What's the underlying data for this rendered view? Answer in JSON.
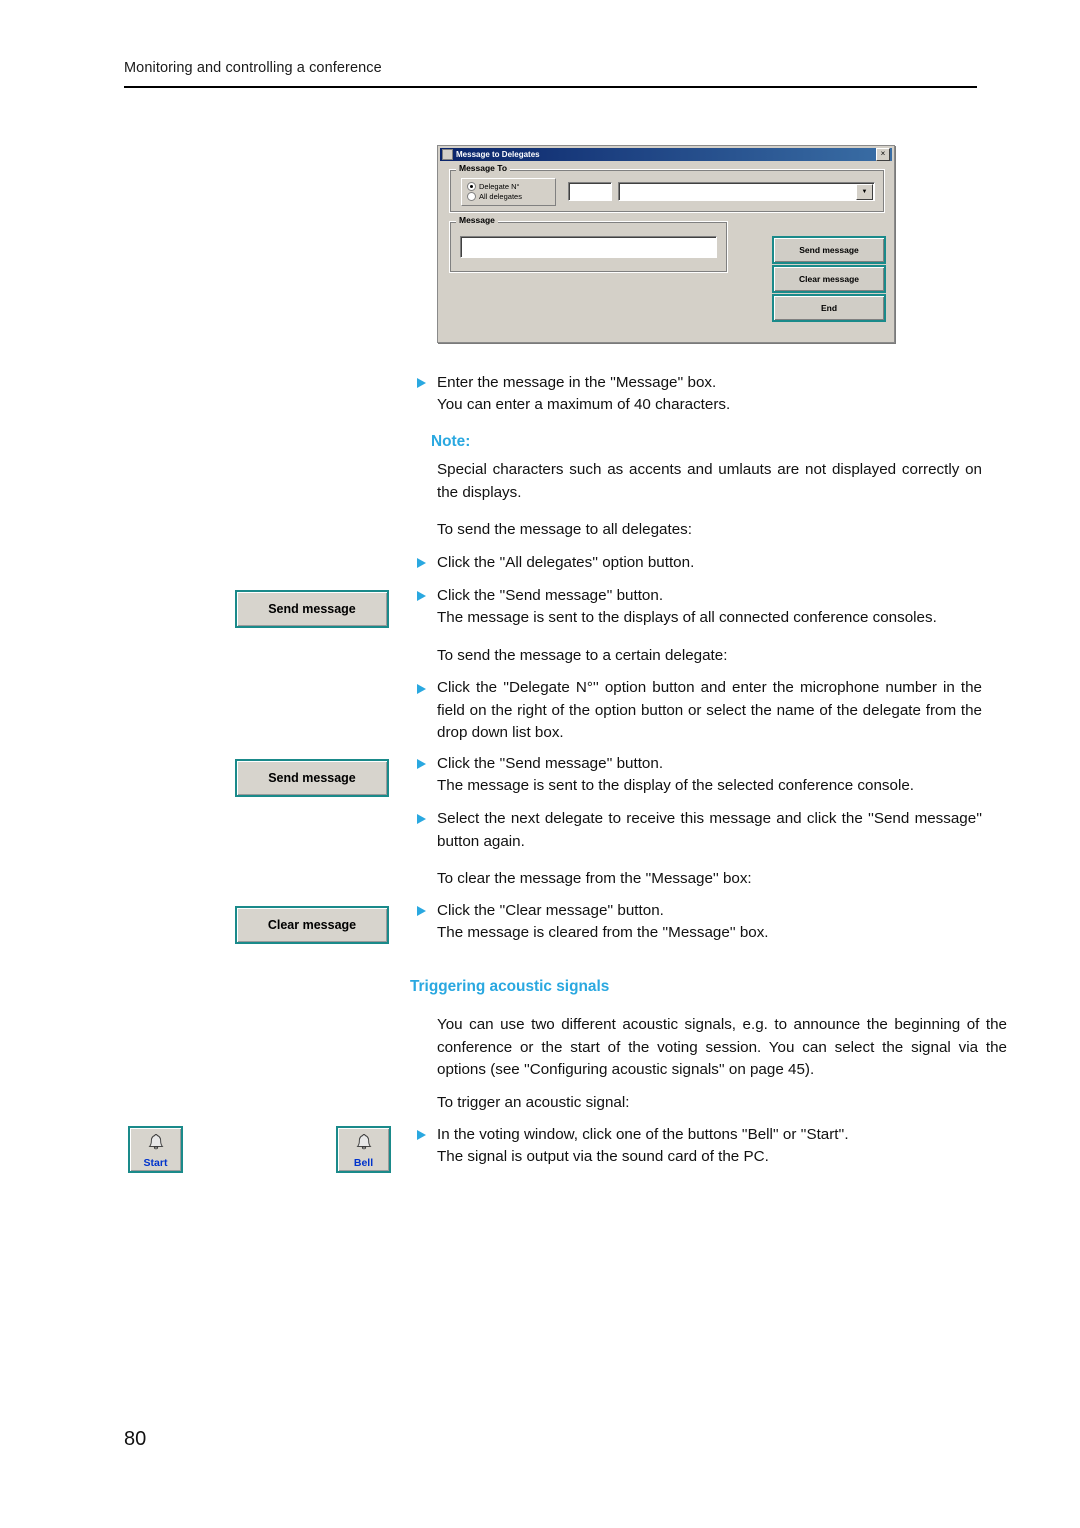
{
  "header": {
    "running_title": "Monitoring and controlling a conference"
  },
  "dialog": {
    "title": "Message to Delegates",
    "close_label": "×",
    "group_message_to": "Message To",
    "group_message": "Message",
    "radio_delegate": "Delegate N°",
    "radio_all": "All delegates",
    "number_value": "",
    "combo_value": "",
    "combo_arrow": "▼",
    "message_value": "",
    "buttons": {
      "send": "Send message",
      "clear": "Clear message",
      "end": "End"
    }
  },
  "body": {
    "step_enter_message": "Enter the message in the ''Message'' box.",
    "step_enter_message_sub": "You can enter a maximum of 40 characters.",
    "note_label": "Note:",
    "note_text": "Special characters such as accents and umlauts are not displayed correctly on the displays.",
    "intro_all": "To send the message to all delegates:",
    "step_click_all": "Click the ''All delegates'' option button.",
    "step_click_send_1": "Click the ''Send message'' button.",
    "step_click_send_1_sub": "The message is sent to the displays of all connected conference consoles.",
    "intro_certain": "To send the message to a certain delegate:",
    "step_click_delegate": "Click the ''Delegate N°'' option button and enter the microphone number in the field on the right of the option button or select the name of the delegate from the drop down list box.",
    "step_click_send_2": "Click the ''Send message'' button.",
    "step_click_send_2_sub": "The message is sent to the display of the selected conference console.",
    "step_select_next": "Select the next delegate to receive this message and click the ''Send message'' button again.",
    "intro_clear": "To clear the message from the ''Message'' box:",
    "step_click_clear": "Click the ''Clear message'' button.",
    "step_click_clear_sub": "The message is cleared from the ''Message'' box.",
    "heading_acoustic": "Triggering acoustic signals",
    "acoustic_para": "You can use two different acoustic signals, e.g. to announce the beginning of the conference or the start of the voting session. You can select the signal via the options (see ''Configuring acoustic signals'' on page 45).",
    "intro_trigger": "To trigger an acoustic signal:",
    "step_trigger": "In the voting window, click one of the buttons ''Bell'' or ''Start''.",
    "step_trigger_sub": "The signal is output via the sound card of the PC."
  },
  "margin": {
    "send_message_1": "Send message",
    "send_message_2": "Send message",
    "clear_message": "Clear message",
    "start_button": "Start",
    "bell_button": "Bell"
  },
  "footer": {
    "page_number": "80"
  },
  "colors": {
    "accent": "#2aa8e0",
    "button_border": "#1a8a8a",
    "button_face": "#d7d4cd",
    "title_bar": "#0a246a"
  }
}
